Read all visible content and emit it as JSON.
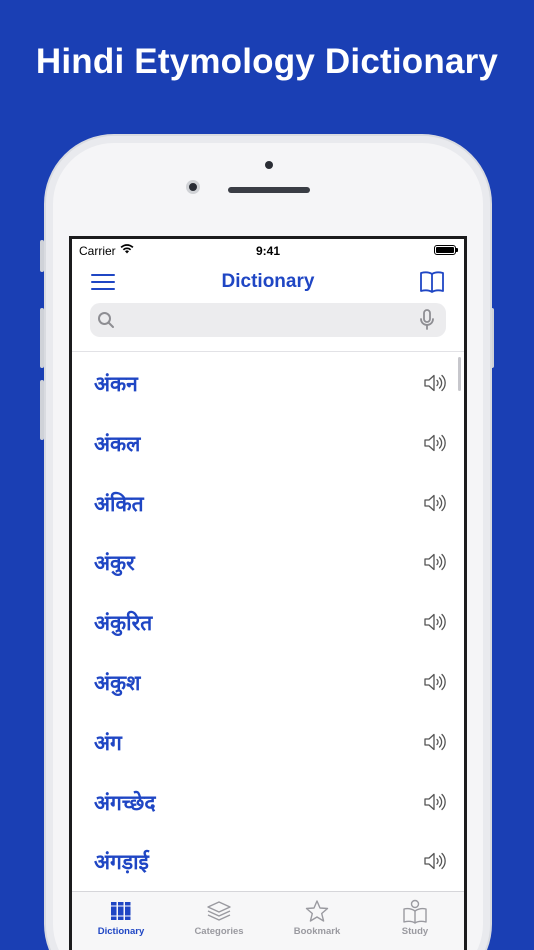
{
  "headline": "Hindi Etymology Dictionary",
  "status_bar": {
    "carrier": "Carrier",
    "time": "9:41"
  },
  "nav": {
    "title": "Dictionary"
  },
  "search": {
    "placeholder": ""
  },
  "words": [
    "अंकन",
    "अंकल",
    "अंकित",
    "अंकुर",
    "अंकुरित",
    "अंकुश",
    "अंग",
    "अंगच्छेद",
    "अंगड़ाई"
  ],
  "tabs": [
    {
      "id": "dictionary",
      "label": "Dictionary",
      "icon": "books-icon",
      "active": true
    },
    {
      "id": "categories",
      "label": "Categories",
      "icon": "layers-icon",
      "active": false
    },
    {
      "id": "bookmark",
      "label": "Bookmark",
      "icon": "star-icon",
      "active": false
    },
    {
      "id": "study",
      "label": "Study",
      "icon": "study-icon",
      "active": false
    }
  ],
  "colors": {
    "background": "#1a3fb4",
    "accent": "#1f46c4",
    "inactive": "#9a9aa0"
  }
}
